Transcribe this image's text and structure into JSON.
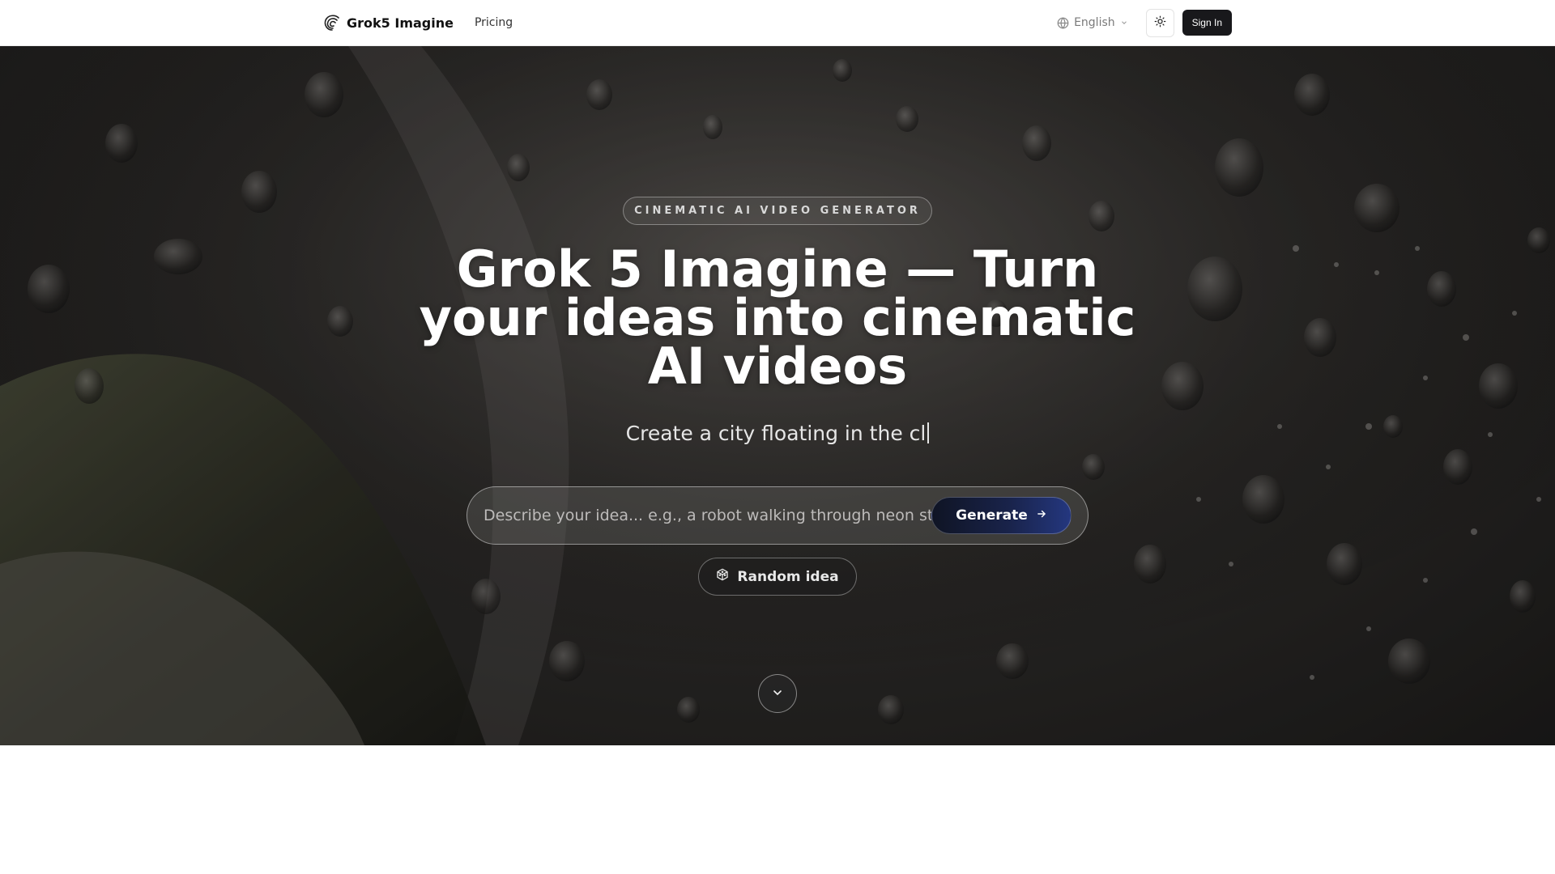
{
  "header": {
    "brand_name": "Grok5 Imagine",
    "nav_pricing": "Pricing",
    "language": "English",
    "signin_label": "Sign In"
  },
  "hero": {
    "badge": "CINEMATIC AI VIDEO GENERATOR",
    "headline": "Grok 5 Imagine — Turn your ideas into cinematic AI videos",
    "typing_text": "Create a city floating in the cl",
    "prompt_placeholder": "Describe your idea... e.g., a robot walking through neon streets",
    "generate_label": "Generate",
    "random_label": "Random idea"
  },
  "icons": {
    "brand": "swirl-logo-icon",
    "language": "globe-icon",
    "language_toggle": "chevron-down-icon",
    "theme": "sun-icon",
    "generate": "arrow-right-icon",
    "random": "dice-icon",
    "scroll": "chevron-down-icon"
  },
  "colors": {
    "signin_bg": "#18181b",
    "generate_gradient_start": "#0f1424",
    "generate_gradient_end": "#24377f"
  }
}
